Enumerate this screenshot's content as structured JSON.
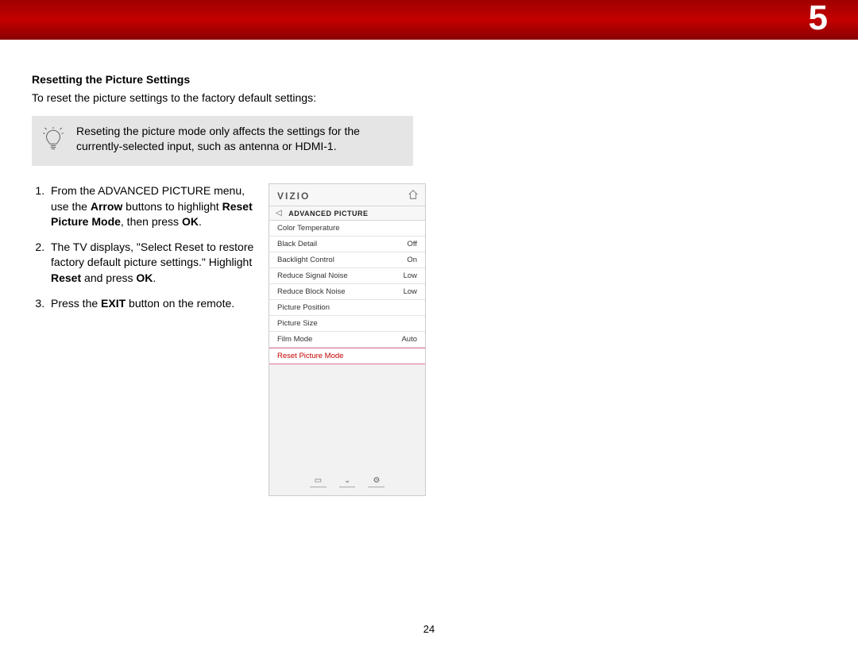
{
  "chapter": "5",
  "page_number": "24",
  "section_title": "Resetting the Picture Settings",
  "intro": "To reset the picture settings to the factory default settings:",
  "tip": "Reseting the picture mode only affects the settings for the currently-selected input, such as antenna or HDMI-1.",
  "steps": {
    "s1a": "From the ADVANCED PICTURE menu, use the ",
    "s1b": "Arrow",
    "s1c": " buttons to highlight ",
    "s1d": "Reset Picture Mode",
    "s1e": ", then press ",
    "s1f": "OK",
    "s1g": ".",
    "s2a": "The TV displays, \"Select Reset to restore factory default picture settings.\" Highlight ",
    "s2b": "Reset",
    "s2c": " and press ",
    "s2d": "OK",
    "s2e": ".",
    "s3a": "Press the ",
    "s3b": "EXIT",
    "s3c": " button on the remote."
  },
  "phone": {
    "brand": "VIZIO",
    "nav_title": "ADVANCED PICTURE",
    "items": [
      {
        "label": "Color Temperature",
        "value": ""
      },
      {
        "label": "Black Detail",
        "value": "Off"
      },
      {
        "label": "Backlight Control",
        "value": "On"
      },
      {
        "label": "Reduce Signal Noise",
        "value": "Low"
      },
      {
        "label": "Reduce Block Noise",
        "value": "Low"
      },
      {
        "label": "Picture Position",
        "value": ""
      },
      {
        "label": "Picture Size",
        "value": ""
      },
      {
        "label": "Film Mode",
        "value": "Auto"
      },
      {
        "label": "Reset Picture Mode",
        "value": "",
        "highlight": true
      }
    ]
  }
}
